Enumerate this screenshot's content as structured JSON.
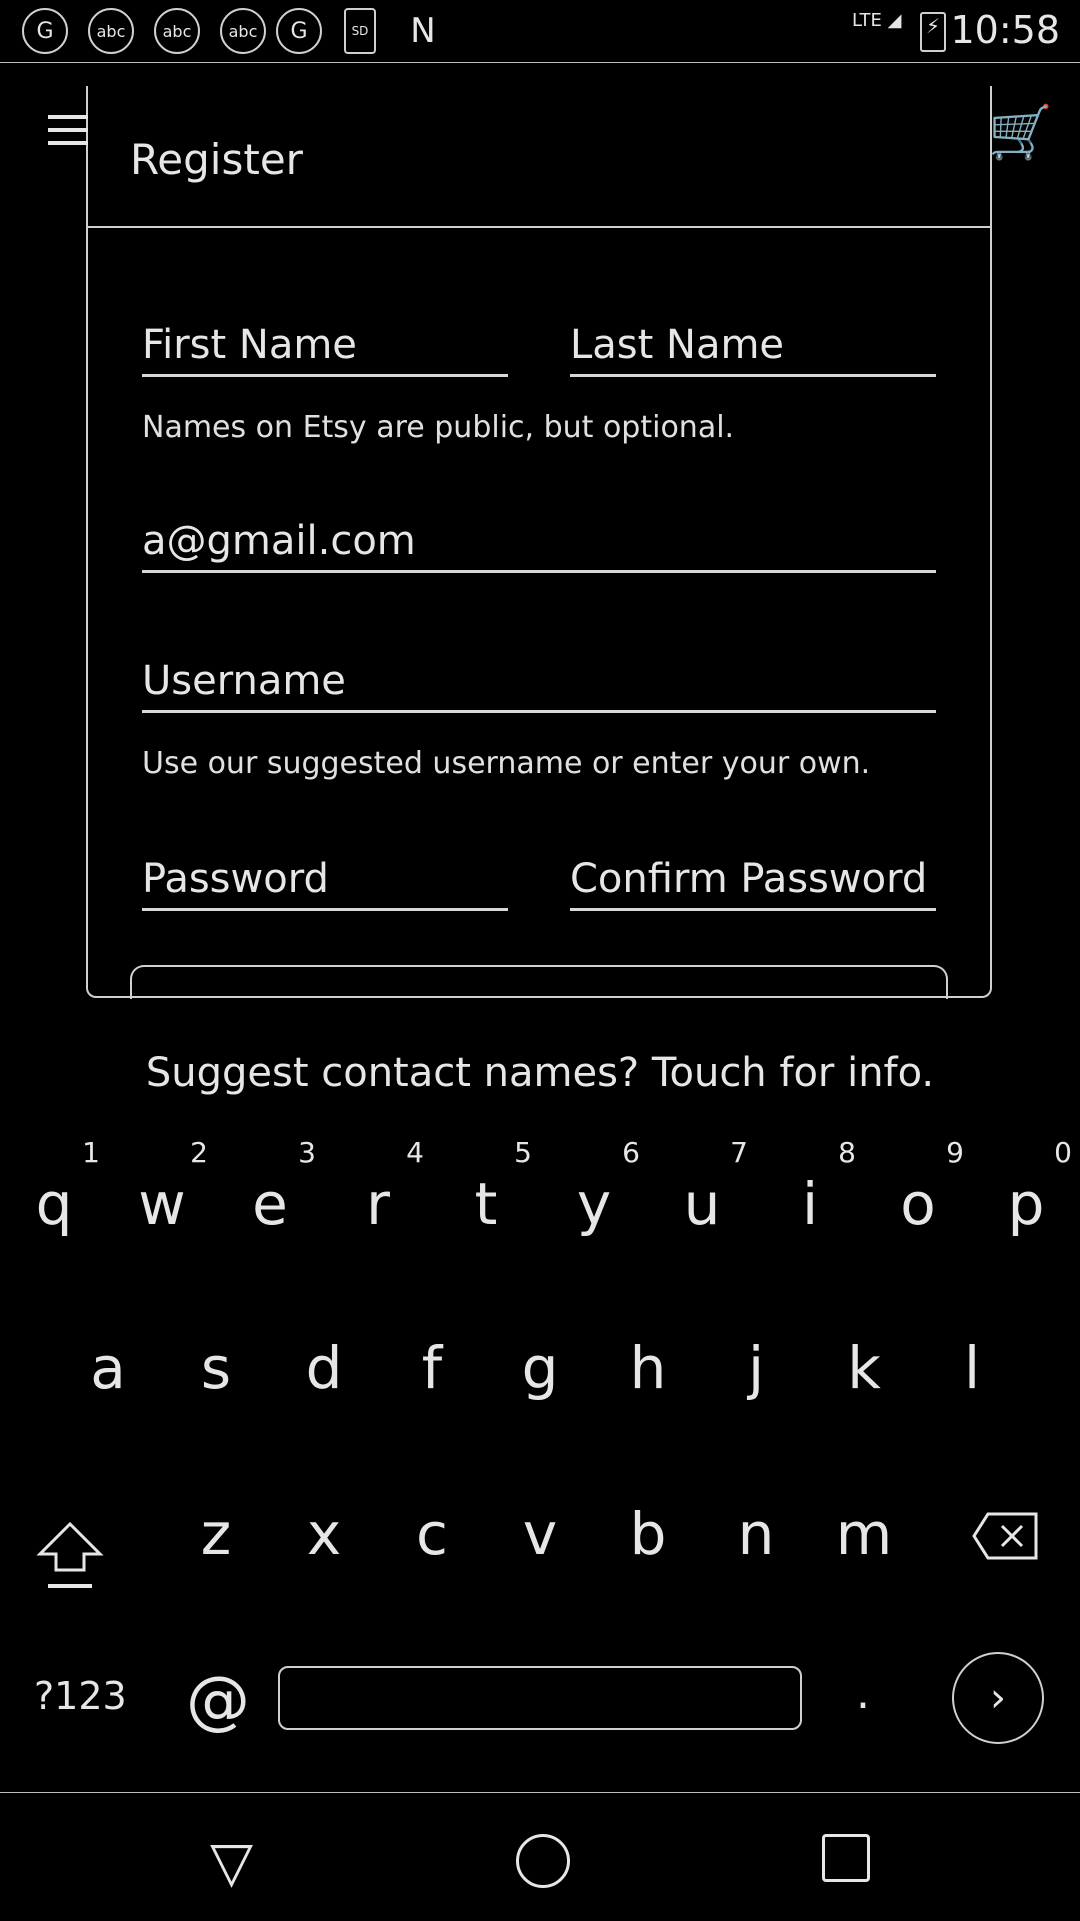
{
  "status_bar": {
    "icons": [
      "G",
      "abc",
      "abc",
      "abc",
      "G",
      "SD",
      "N"
    ],
    "network": "LTE",
    "time": "10:58"
  },
  "app_bar": {
    "title": "Register"
  },
  "form": {
    "first_name_placeholder": "First Name",
    "last_name_placeholder": "Last Name",
    "names_helper": "Names on Etsy are public, but optional.",
    "email_value": "a@gmail.com",
    "username_placeholder": "Username",
    "username_helper": "Use our suggested username or enter your own.",
    "password_placeholder": "Password",
    "confirm_password_placeholder": "Confirm Password"
  },
  "suggestion_bar": "Suggest contact names? Touch for info.",
  "keyboard": {
    "row1": [
      "q",
      "w",
      "e",
      "r",
      "t",
      "y",
      "u",
      "i",
      "o",
      "p"
    ],
    "row1_hints": [
      "1",
      "2",
      "3",
      "4",
      "5",
      "6",
      "7",
      "8",
      "9",
      "0"
    ],
    "row2": [
      "a",
      "s",
      "d",
      "f",
      "g",
      "h",
      "j",
      "k",
      "l"
    ],
    "row3": [
      "z",
      "x",
      "c",
      "v",
      "b",
      "n",
      "m"
    ],
    "symbols_key": "?123",
    "at_key": "@",
    "period_key": "."
  }
}
